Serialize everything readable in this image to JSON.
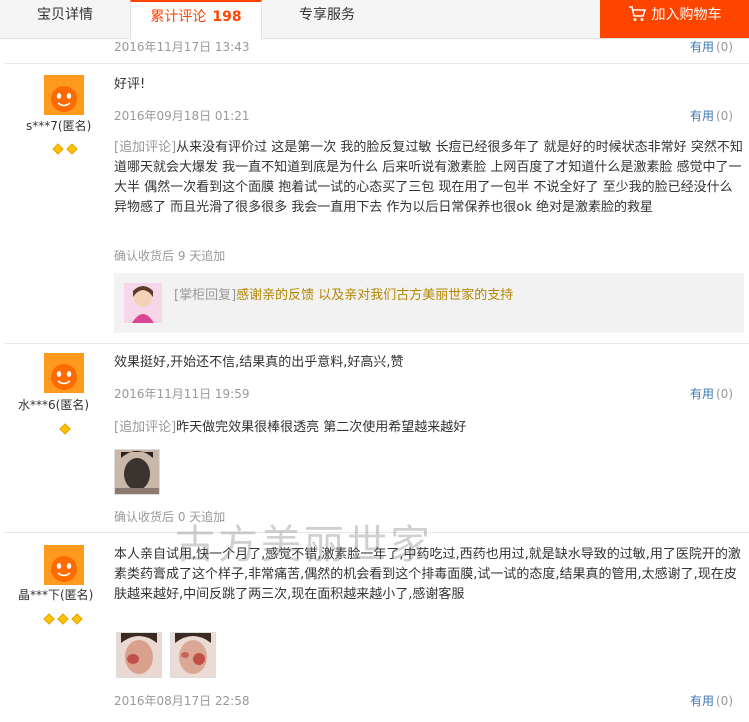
{
  "tabs": {
    "details": "宝贝详情",
    "reviews": "累计评论",
    "reviews_count": "198",
    "service": "专享服务",
    "cart": "加入购物车"
  },
  "colors": {
    "accent": "#ff4400",
    "link": "#3c78b5",
    "muted": "#999999",
    "reply": "#b48500"
  },
  "useful_label": "有用",
  "useful_count": "(0)",
  "top_fragment": {
    "date": "2016年11月17日 13:43"
  },
  "reviews": [
    {
      "user": "s***7(匿名)",
      "badges": 2,
      "text": "好评!",
      "date": "2016年09月18日 01:21",
      "append_tag": "[追加评论]",
      "append_text": "从来没有评价过 这是第一次 我的脸反复过敏 长痘已经很多年了 就是好的时候状态非常好 突然不知道哪天就会大爆发 我一直不知道到底是为什么 后来听说有激素脸 上网百度了才知道什么是激素脸 感觉中了一大半 偶然一次看到这个面膜 抱着试一试的心态买了三包 现在用了一包半 不说全好了 至少我的脸已经没什么异物感了 而且光滑了很多很多 我会一直用下去 作为以后日常保养也很ok 绝对是激素脸的救星",
      "append_meta": "确认收货后 9 天追加",
      "reply_tag": "[掌柜回复]",
      "reply_text": "感谢亲的反馈 以及亲对我们古方美丽世家的支持"
    },
    {
      "user": "水***6(匿名)",
      "badges": 1,
      "text": "效果挺好,开始还不信,结果真的出乎意料,好高兴,赞",
      "date": "2016年11月11日 19:59",
      "append_tag": "[追加评论]",
      "append_text": "昨天做完效果很棒很透亮 第二次使用希望越来越好",
      "append_meta": "确认收货后 0 天追加"
    },
    {
      "user": "晶***下(匿名)",
      "badges": 3,
      "text": "本人亲自试用,快一个月了,感觉不错,激素脸一年了,中药吃过,西药也用过,就是缺水导致的过敏,用了医院开的激素类药膏成了这个样子,非常痛苦,偶然的机会看到这个排毒面膜,试一试的态度,结果真的管用,太感谢了,现在皮肤越来越好,中间反跳了两三次,现在面积越来越小了,感谢客服",
      "date": "2016年08月17日 22:58"
    }
  ],
  "watermark": "古方美丽世家"
}
